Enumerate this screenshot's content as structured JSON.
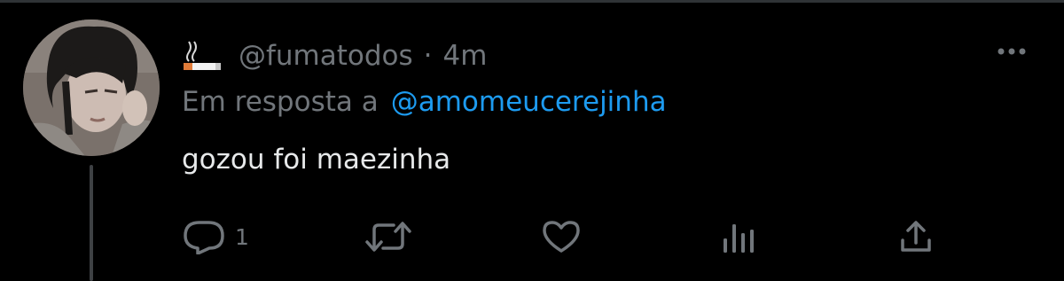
{
  "tweet": {
    "author_emoji": "🚬",
    "handle": "@fumatodos",
    "separator": "·",
    "time": "4m",
    "reply_prefix": "Em resposta a",
    "reply_to": "@amomeucerejinha",
    "text": "gozou foi maezinha"
  },
  "actions": {
    "reply_count": "1",
    "icons": [
      "reply-icon",
      "retweet-icon",
      "like-icon",
      "views-icon",
      "share-icon"
    ]
  },
  "colors": {
    "background": "#000000",
    "text_primary": "#e7e9ea",
    "text_secondary": "#71767b",
    "link": "#1d9bf0",
    "thread_line": "#3e4144"
  }
}
